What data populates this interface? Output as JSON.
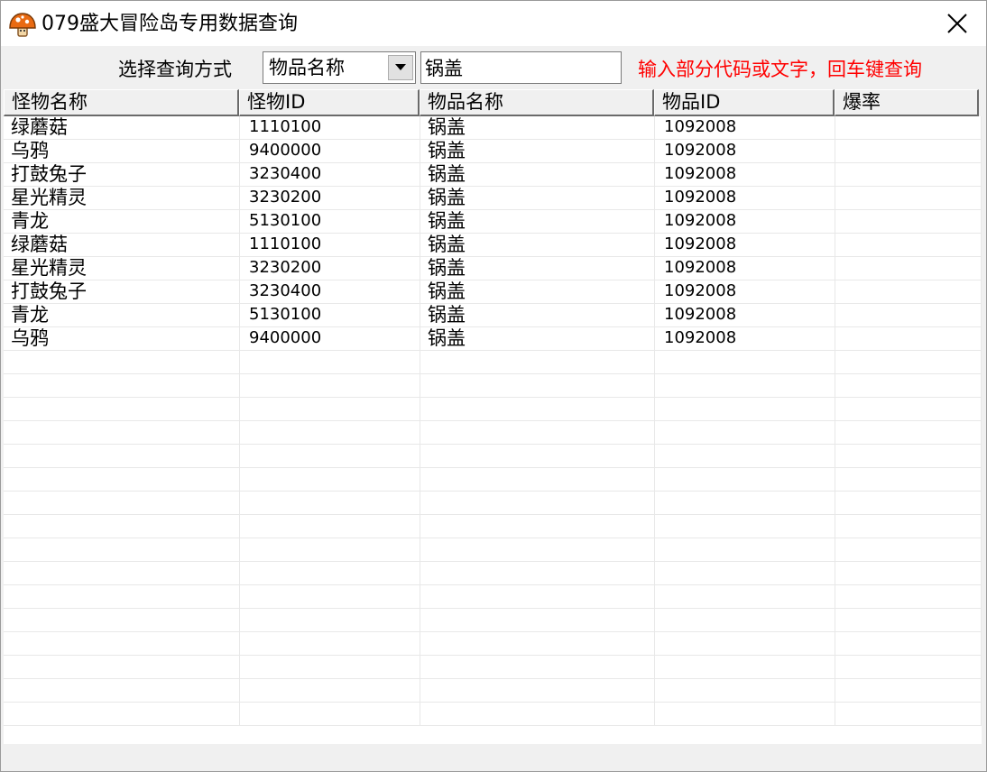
{
  "window": {
    "title": "079盛大冒险岛专用数据查询"
  },
  "icons": {
    "app": "mushroom-app-icon",
    "close": "close-icon",
    "dropdown": "chevron-down-icon"
  },
  "query": {
    "label": "选择查询方式",
    "mode": "物品名称",
    "search_value": "锅盖",
    "hint": "输入部分代码或文字，回车键查询",
    "hint_color": "#ff0000"
  },
  "table": {
    "columns": [
      "怪物名称",
      "怪物ID",
      "物品名称",
      "物品ID",
      "爆率"
    ],
    "rows": [
      [
        "绿蘑菇",
        "1110100",
        "锅盖",
        "1092008",
        ""
      ],
      [
        "乌鸦",
        "9400000",
        "锅盖",
        "1092008",
        ""
      ],
      [
        "打鼓兔子",
        "3230400",
        "锅盖",
        "1092008",
        ""
      ],
      [
        "星光精灵",
        "3230200",
        "锅盖",
        "1092008",
        ""
      ],
      [
        "青龙",
        "5130100",
        "锅盖",
        "1092008",
        ""
      ],
      [
        "绿蘑菇",
        "1110100",
        "锅盖",
        "1092008",
        ""
      ],
      [
        "星光精灵",
        "3230200",
        "锅盖",
        "1092008",
        ""
      ],
      [
        "打鼓兔子",
        "3230400",
        "锅盖",
        "1092008",
        ""
      ],
      [
        "青龙",
        "5130100",
        "锅盖",
        "1092008",
        ""
      ],
      [
        "乌鸦",
        "9400000",
        "锅盖",
        "1092008",
        ""
      ]
    ]
  }
}
